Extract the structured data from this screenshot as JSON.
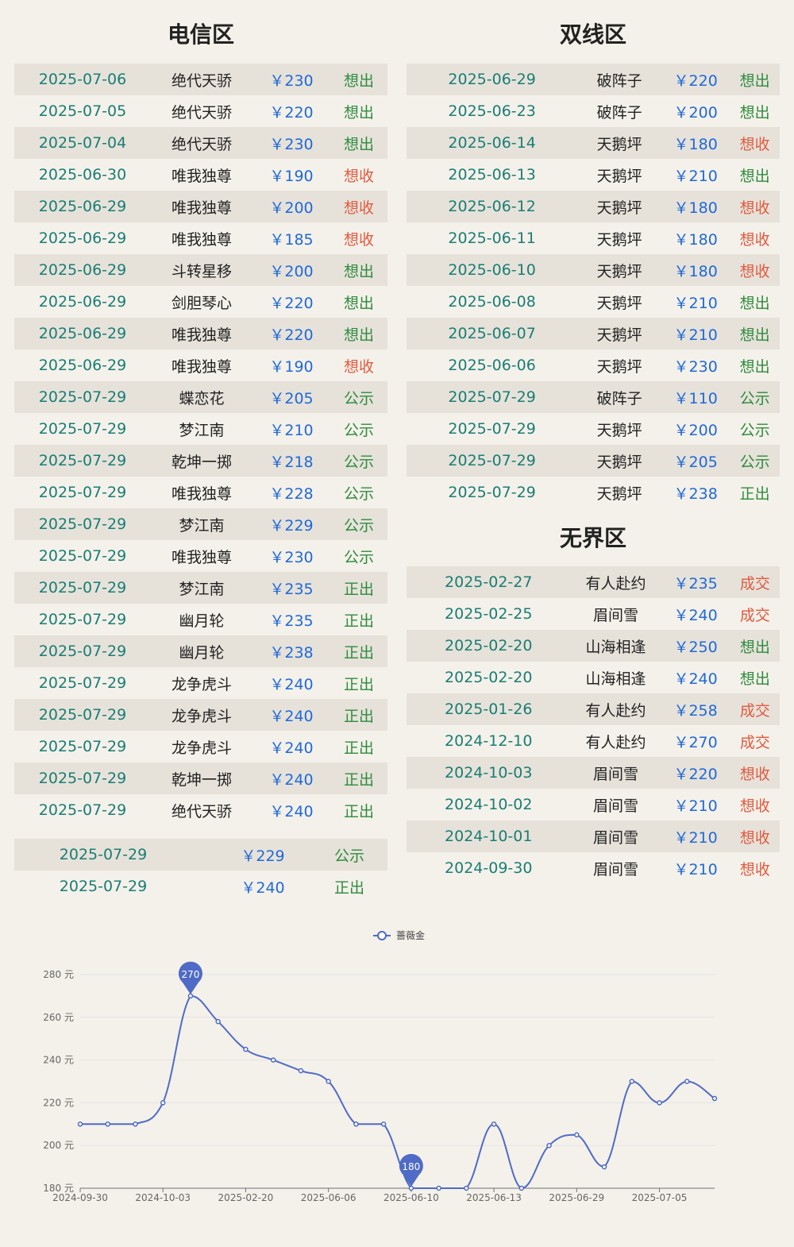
{
  "sections": {
    "telecom": {
      "title": "电信区",
      "rows": [
        {
          "date": "2025-07-06",
          "name": "绝代天骄",
          "price": "￥230",
          "status": "想出"
        },
        {
          "date": "2025-07-05",
          "name": "绝代天骄",
          "price": "￥220",
          "status": "想出"
        },
        {
          "date": "2025-07-04",
          "name": "绝代天骄",
          "price": "￥230",
          "status": "想出"
        },
        {
          "date": "2025-06-30",
          "name": "唯我独尊",
          "price": "￥190",
          "status": "想收"
        },
        {
          "date": "2025-06-29",
          "name": "唯我独尊",
          "price": "￥200",
          "status": "想收"
        },
        {
          "date": "2025-06-29",
          "name": "唯我独尊",
          "price": "￥185",
          "status": "想收"
        },
        {
          "date": "2025-06-29",
          "name": "斗转星移",
          "price": "￥200",
          "status": "想出"
        },
        {
          "date": "2025-06-29",
          "name": "剑胆琴心",
          "price": "￥220",
          "status": "想出"
        },
        {
          "date": "2025-06-29",
          "name": "唯我独尊",
          "price": "￥220",
          "status": "想出"
        },
        {
          "date": "2025-06-29",
          "name": "唯我独尊",
          "price": "￥190",
          "status": "想收"
        },
        {
          "date": "2025-07-29",
          "name": "蝶恋花",
          "price": "￥205",
          "status": "公示"
        },
        {
          "date": "2025-07-29",
          "name": "梦江南",
          "price": "￥210",
          "status": "公示"
        },
        {
          "date": "2025-07-29",
          "name": "乾坤一掷",
          "price": "￥218",
          "status": "公示"
        },
        {
          "date": "2025-07-29",
          "name": "唯我独尊",
          "price": "￥228",
          "status": "公示"
        },
        {
          "date": "2025-07-29",
          "name": "梦江南",
          "price": "￥229",
          "status": "公示"
        },
        {
          "date": "2025-07-29",
          "name": "唯我独尊",
          "price": "￥230",
          "status": "公示"
        },
        {
          "date": "2025-07-29",
          "name": "梦江南",
          "price": "￥235",
          "status": "正出"
        },
        {
          "date": "2025-07-29",
          "name": "幽月轮",
          "price": "￥235",
          "status": "正出"
        },
        {
          "date": "2025-07-29",
          "name": "幽月轮",
          "price": "￥238",
          "status": "正出"
        },
        {
          "date": "2025-07-29",
          "name": "龙争虎斗",
          "price": "￥240",
          "status": "正出"
        },
        {
          "date": "2025-07-29",
          "name": "龙争虎斗",
          "price": "￥240",
          "status": "正出"
        },
        {
          "date": "2025-07-29",
          "name": "龙争虎斗",
          "price": "￥240",
          "status": "正出"
        },
        {
          "date": "2025-07-29",
          "name": "乾坤一掷",
          "price": "￥240",
          "status": "正出"
        },
        {
          "date": "2025-07-29",
          "name": "绝代天骄",
          "price": "￥240",
          "status": "正出"
        }
      ],
      "summary": [
        {
          "date": "2025-07-29",
          "price": "￥229",
          "status": "公示"
        },
        {
          "date": "2025-07-29",
          "price": "￥240",
          "status": "正出"
        }
      ]
    },
    "dual": {
      "title": "双线区",
      "rows": [
        {
          "date": "2025-06-29",
          "name": "破阵子",
          "price": "￥220",
          "status": "想出"
        },
        {
          "date": "2025-06-23",
          "name": "破阵子",
          "price": "￥200",
          "status": "想出"
        },
        {
          "date": "2025-06-14",
          "name": "天鹅坪",
          "price": "￥180",
          "status": "想收"
        },
        {
          "date": "2025-06-13",
          "name": "天鹅坪",
          "price": "￥210",
          "status": "想出"
        },
        {
          "date": "2025-06-12",
          "name": "天鹅坪",
          "price": "￥180",
          "status": "想收"
        },
        {
          "date": "2025-06-11",
          "name": "天鹅坪",
          "price": "￥180",
          "status": "想收"
        },
        {
          "date": "2025-06-10",
          "name": "天鹅坪",
          "price": "￥180",
          "status": "想收"
        },
        {
          "date": "2025-06-08",
          "name": "天鹅坪",
          "price": "￥210",
          "status": "想出"
        },
        {
          "date": "2025-06-07",
          "name": "天鹅坪",
          "price": "￥210",
          "status": "想出"
        },
        {
          "date": "2025-06-06",
          "name": "天鹅坪",
          "price": "￥230",
          "status": "想出"
        },
        {
          "date": "2025-07-29",
          "name": "破阵子",
          "price": "￥110",
          "status": "公示"
        },
        {
          "date": "2025-07-29",
          "name": "天鹅坪",
          "price": "￥200",
          "status": "公示"
        },
        {
          "date": "2025-07-29",
          "name": "天鹅坪",
          "price": "￥205",
          "status": "公示"
        },
        {
          "date": "2025-07-29",
          "name": "天鹅坪",
          "price": "￥238",
          "status": "正出"
        }
      ]
    },
    "boundless": {
      "title": "无界区",
      "rows": [
        {
          "date": "2025-02-27",
          "name": "有人赴约",
          "price": "￥235",
          "status": "成交"
        },
        {
          "date": "2025-02-25",
          "name": "眉间雪",
          "price": "￥240",
          "status": "成交"
        },
        {
          "date": "2025-02-20",
          "name": "山海相逢",
          "price": "￥250",
          "status": "想出"
        },
        {
          "date": "2025-02-20",
          "name": "山海相逢",
          "price": "￥240",
          "status": "想出"
        },
        {
          "date": "2025-01-26",
          "name": "有人赴约",
          "price": "￥258",
          "status": "成交"
        },
        {
          "date": "2024-12-10",
          "name": "有人赴约",
          "price": "￥270",
          "status": "成交"
        },
        {
          "date": "2024-10-03",
          "name": "眉间雪",
          "price": "￥220",
          "status": "想收"
        },
        {
          "date": "2024-10-02",
          "name": "眉间雪",
          "price": "￥210",
          "status": "想收"
        },
        {
          "date": "2024-10-01",
          "name": "眉间雪",
          "price": "￥210",
          "status": "想收"
        },
        {
          "date": "2024-09-30",
          "name": "眉间雪",
          "price": "￥210",
          "status": "想收"
        }
      ]
    }
  },
  "status_colors": {
    "想出": "#2e8b3d",
    "想收": "#e25a3f",
    "公示": "#2e8b3d",
    "正出": "#2e8b3d",
    "成交": "#e25a3f"
  },
  "chart_data": {
    "type": "line",
    "smooth": true,
    "legend": "蔷薇金",
    "legend_position": "top-center",
    "series": [
      {
        "name": "蔷薇金",
        "color": "#4f6bc6",
        "values": [
          210,
          210,
          210,
          220,
          270,
          258,
          245,
          240,
          235,
          230,
          210,
          210,
          180,
          180,
          180,
          210,
          180,
          200,
          205,
          190,
          230,
          220,
          230,
          222
        ]
      }
    ],
    "x_tick_labels": [
      "2024-09-30",
      "2024-10-03",
      "2025-02-20",
      "2025-06-06",
      "2025-06-10",
      "2025-06-13",
      "2025-06-29",
      "2025-07-05"
    ],
    "x_tick_indices": [
      0,
      3,
      6,
      9,
      12,
      15,
      18,
      21
    ],
    "y_ticks": [
      180,
      200,
      220,
      240,
      260,
      280
    ],
    "y_unit": "元",
    "ylim": [
      180,
      280
    ],
    "grid": true,
    "markers": [
      {
        "label": "270",
        "index": 4,
        "value": 270
      },
      {
        "label": "180",
        "index": 12,
        "value": 180
      }
    ]
  }
}
